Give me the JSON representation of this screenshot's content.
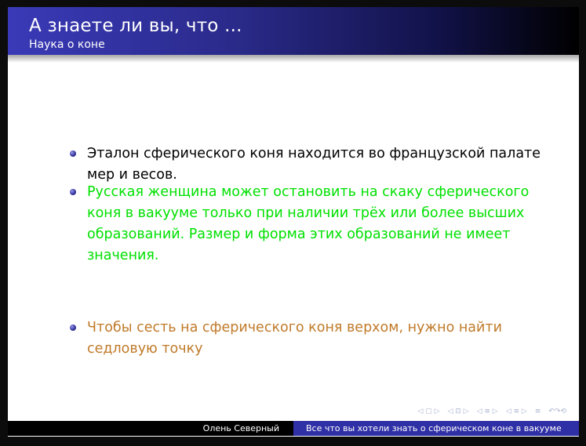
{
  "slide": {
    "title": "А знаете ли вы, что ...",
    "subtitle": "Наука о коне"
  },
  "items": [
    {
      "text": "Эталон сферического коня находится во французской палате мер и весов.",
      "color": "#000000"
    },
    {
      "text": "Русская женщина может остановить на скаку сферического коня в вакууме только при наличии трёх или более высших образований. Размер и форма этих образований не имеет значения.",
      "color": "#00e000"
    },
    {
      "text": "Чтобы сесть на сферического коня верхом, нужно найти седловую точку",
      "color": "#c07a2a"
    }
  ],
  "navigation": {
    "icons": [
      "nav-frame-icon",
      "nav-subsection-icon",
      "nav-section-icon",
      "nav-section-icon",
      "nav-doc-icon",
      "nav-search-icon"
    ],
    "glyphs": [
      "◁ ▢ ▷",
      "◁ ⊡ ▷",
      "◁ ≡ ▷",
      "◁ ≡ ▷",
      "≡",
      "↶↷⟲"
    ]
  },
  "footer": {
    "author": "Олень Северный",
    "title": "Все что вы хотели знать о сферическом коне в вакууме"
  }
}
